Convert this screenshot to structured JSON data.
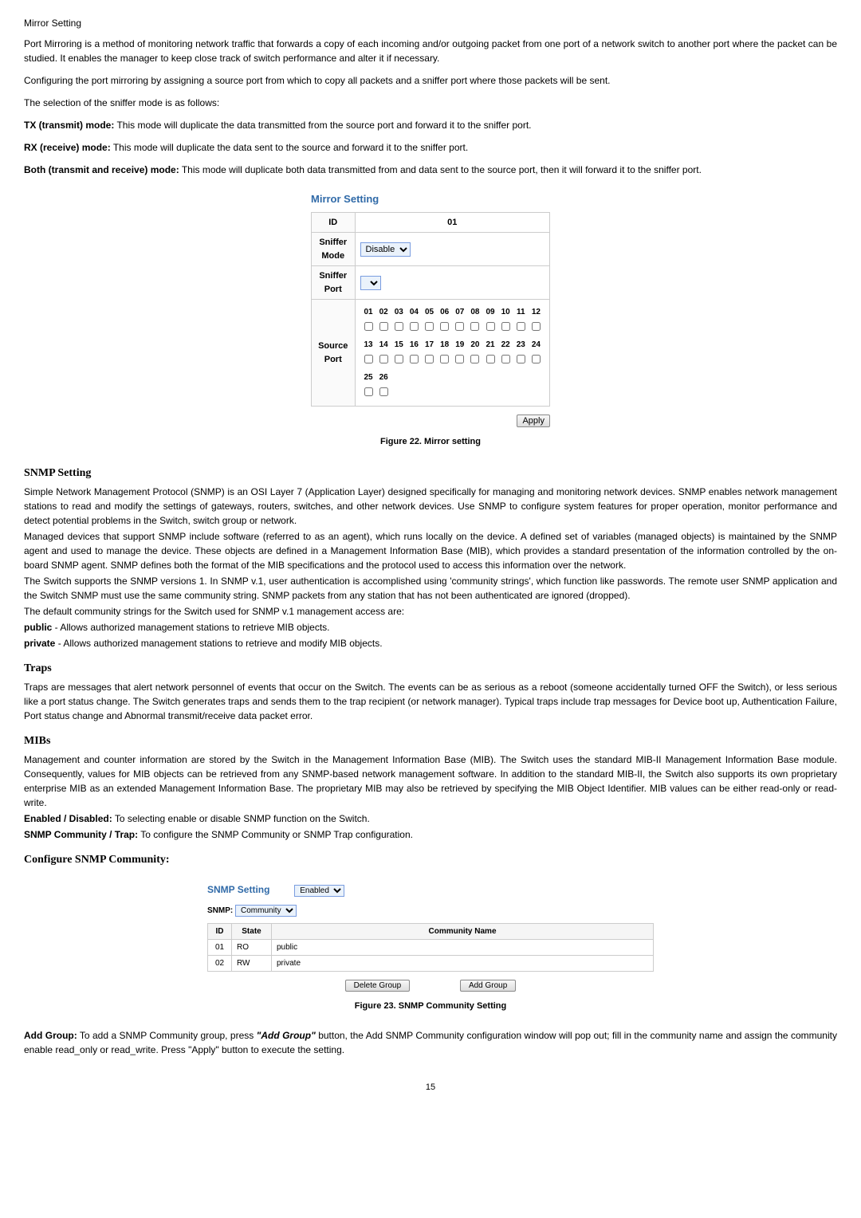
{
  "mirror_section": {
    "title": "Mirror Setting",
    "p1": "Port Mirroring is a method of monitoring network traffic that forwards a copy of each incoming and/or outgoing packet from one port of a network switch to another port where the packet can be studied. It enables the manager to keep close track of switch performance and alter it if necessary.",
    "p2": "Configuring the port mirroring by assigning a source port from which to copy all packets and a sniffer port where those packets will be sent.",
    "p3": "The selection of the sniffer mode is as follows:",
    "tx_label": "TX (transmit) mode:",
    "tx_text": " This mode will duplicate the data transmitted from the source port and forward it to the sniffer port.",
    "rx_label": "RX (receive) mode:",
    "rx_text": " This mode will duplicate the data sent to the source and forward it to the sniffer port.",
    "both_label": "Both (transmit and receive) mode:",
    "both_text": " This mode will duplicate both data transmitted from and data sent to the source port, then it will forward it to the sniffer port."
  },
  "mirror_figure": {
    "panel_title": "Mirror Setting",
    "id_label": "ID",
    "id_value": "01",
    "sniffer_mode_label": "Sniffer Mode",
    "sniffer_mode_value": "Disable",
    "sniffer_port_label": "Sniffer Port",
    "source_port_label": "Source Port",
    "row1": [
      "01",
      "02",
      "03",
      "04",
      "05",
      "06",
      "07",
      "08",
      "09",
      "10",
      "11",
      "12"
    ],
    "row2": [
      "13",
      "14",
      "15",
      "16",
      "17",
      "18",
      "19",
      "20",
      "21",
      "22",
      "23",
      "24"
    ],
    "row3": [
      "25",
      "26"
    ],
    "apply": "Apply",
    "caption": "Figure 22. Mirror setting"
  },
  "snmp_section": {
    "heading": "SNMP Setting",
    "p1": "Simple Network Management Protocol (SNMP) is an OSI Layer 7 (Application Layer) designed specifically for managing and monitoring network devices. SNMP enables network management stations to read and modify the settings of gateways, routers, switches, and other network devices. Use SNMP to configure system features for proper operation, monitor performance and detect potential problems in the Switch, switch group or network.",
    "p2": "Managed devices that support SNMP include software (referred to as an agent), which runs locally on the device. A defined set of variables (managed objects) is maintained by the SNMP agent and used to manage the device. These objects are defined in a Management Information Base (MIB), which provides a standard presentation of the information controlled by the on-board SNMP agent. SNMP defines both the format of the MIB specifications and the protocol used to access this information over the network.",
    "p3": "The Switch supports the SNMP versions 1. In SNMP v.1, user authentication is accomplished using 'community strings', which function like passwords. The remote user SNMP application and the Switch SNMP must use the same community string. SNMP packets from any station that has not been authenticated are ignored (dropped).",
    "p4": "The default community strings for the Switch used for SNMP v.1 management access are:",
    "public_label": "public",
    "public_text": " - Allows authorized management stations to retrieve MIB objects.",
    "private_label": "private",
    "private_text": " - Allows authorized management stations to retrieve and modify MIB objects."
  },
  "traps_section": {
    "heading": "Traps",
    "p1": "Traps are messages that alert network personnel of events that occur on the Switch. The events can be as serious as a reboot (someone accidentally turned OFF the Switch), or less serious like a port status change. The Switch generates traps and sends them to the trap recipient (or network manager). Typical traps include trap messages for Device boot up, Authentication Failure, Port status change and Abnormal transmit/receive data packet error."
  },
  "mibs_section": {
    "heading": "MIBs",
    "p1": "Management and counter information are stored by the Switch in the Management Information Base (MIB). The Switch uses the standard MIB-II Management Information Base module. Consequently, values for MIB objects can be retrieved from any SNMP-based network management software. In addition to the standard MIB-II, the Switch also supports its own proprietary enterprise MIB as an extended Management Information Base. The proprietary MIB may also be retrieved by specifying the MIB Object Identifier. MIB values can be either read-only or read-write.",
    "enabled_label": "Enabled / Disabled:",
    "enabled_text": " To selecting enable or disable SNMP function on the Switch.",
    "community_label": "SNMP Community / Trap:",
    "community_text": " To configure the SNMP Community or SNMP Trap configuration."
  },
  "configure_section": {
    "heading": "Configure SNMP Community:"
  },
  "snmp_figure": {
    "panel_title": "SNMP Setting",
    "enabled_value": "Enabled",
    "snmp_label": "SNMP:",
    "snmp_value": "Community",
    "th_id": "ID",
    "th_state": "State",
    "th_name": "Community Name",
    "rows": [
      {
        "id": "01",
        "state": "RO",
        "name": "public"
      },
      {
        "id": "02",
        "state": "RW",
        "name": "private"
      }
    ],
    "delete_btn": "Delete Group",
    "add_btn": "Add Group",
    "caption": "Figure 23. SNMP Community Setting"
  },
  "add_group": {
    "label": "Add Group:",
    "pre_text": " To add a SNMP Community group, press ",
    "btn_text": "\"Add Group\"",
    "post_text": " button, the Add SNMP Community configuration window will pop out; fill in the community name and assign the community enable read_only or read_write. Press \"Apply\" button to execute the setting."
  },
  "page_number": "15"
}
